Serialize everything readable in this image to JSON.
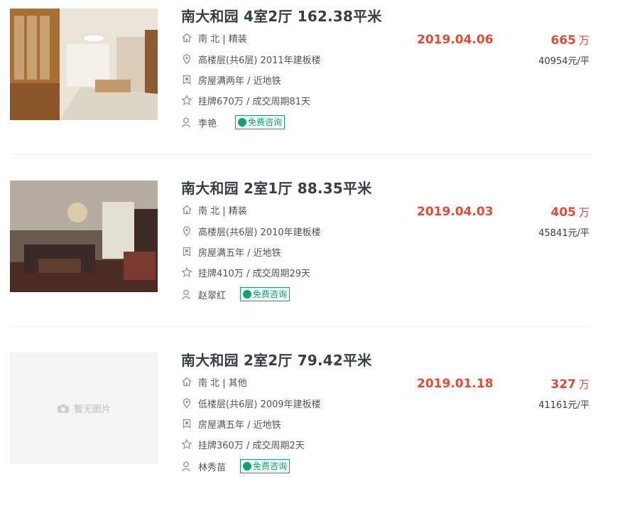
{
  "listings": [
    {
      "title": "南大和园 4室2厅 162.38平米",
      "orientation_decor": "南 北 | 精装",
      "floor_info": "高楼层(共6层) 2011年建板楼",
      "tags": "房屋满两年 / 近地铁",
      "deal_info": "挂牌670万 / 成交周期81天",
      "agent": "李艳",
      "consult_label": "免费咨询",
      "date": "2019.04.06",
      "price": "665",
      "price_unit": "万",
      "unit_price": "40954元/平",
      "has_image": true
    },
    {
      "title": "南大和园 2室1厅 88.35平米",
      "orientation_decor": "南 北 | 精装",
      "floor_info": "高楼层(共6层) 2010年建板楼",
      "tags": "房屋满五年 / 近地铁",
      "deal_info": "挂牌410万 / 成交周期29天",
      "agent": "赵翠红",
      "consult_label": "免费咨询",
      "date": "2019.04.03",
      "price": "405",
      "price_unit": "万",
      "unit_price": "45841元/平",
      "has_image": true
    },
    {
      "title": "南大和园 2室2厅 79.42平米",
      "orientation_decor": "南 北 | 其他",
      "floor_info": "低楼层(共6层) 2009年建板楼",
      "tags": "房屋满五年 / 近地铁",
      "deal_info": "挂牌360万 / 成交周期2天",
      "agent": "林秀苗",
      "consult_label": "免费咨询",
      "date": "2019.01.18",
      "price": "327",
      "price_unit": "万",
      "unit_price": "41161元/平",
      "has_image": false,
      "no_image_text": "暂无图片"
    }
  ],
  "colors": {
    "accent_red": "#e24b35",
    "consult_green": "#10a36b",
    "text_dark": "#394043"
  },
  "icons": [
    "house-icon",
    "location-pin-icon",
    "certificate-icon",
    "star-icon",
    "person-icon",
    "chat-bubble-icon",
    "camera-icon"
  ]
}
